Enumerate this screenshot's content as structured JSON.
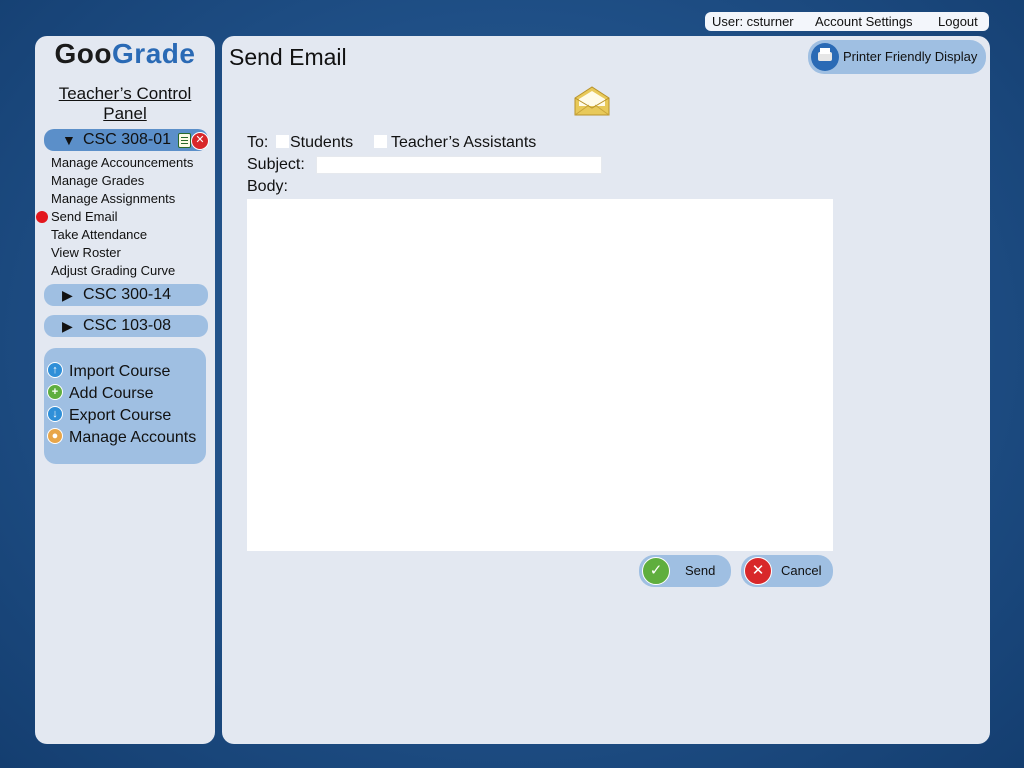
{
  "topbar": {
    "user": "User: csturner",
    "account_settings": "Account Settings",
    "logout": "Logout"
  },
  "sidebar": {
    "logo_goo": "Goo",
    "logo_grade": "Grade",
    "panel_title": "Teacher’s Control Panel",
    "courses": [
      {
        "name": "CSC 308-01",
        "expanded": true,
        "arrow": "▼"
      },
      {
        "name": "CSC 300-14",
        "expanded": false,
        "arrow": "▶"
      },
      {
        "name": "CSC 103-08",
        "expanded": false,
        "arrow": "▶"
      }
    ],
    "menu": [
      {
        "label": "Manage Accouncements"
      },
      {
        "label": "Manage Grades"
      },
      {
        "label": "Manage Assignments"
      },
      {
        "label": "Send Email",
        "selected": true
      },
      {
        "label": "Take Attendance"
      },
      {
        "label": "View Roster"
      },
      {
        "label": "Adjust Grading Curve"
      }
    ],
    "actions": [
      {
        "label": "Import Course",
        "icon": "import-icon"
      },
      {
        "label": "Add Course",
        "icon": "add-icon"
      },
      {
        "label": "Export Course",
        "icon": "export-icon"
      },
      {
        "label": "Manage Accounts",
        "icon": "accounts-icon"
      }
    ]
  },
  "main": {
    "title": "Send Email",
    "print_label": "Printer Friendly Display",
    "form": {
      "to_label": "To:",
      "students_label": "Students",
      "tas_label": "Teacher’s Assistants",
      "subject_label": "Subject:",
      "subject_value": "",
      "body_label": "Body:",
      "body_value": ""
    },
    "send_label": "Send",
    "cancel_label": "Cancel"
  },
  "colors": {
    "background": "#1f4f86",
    "panel": "#e3e8f1",
    "accent_light": "#9fbfe2",
    "accent_active": "#5b8fc9",
    "brand_blue": "#2a6ab5",
    "selected_dot": "#e3161d"
  }
}
